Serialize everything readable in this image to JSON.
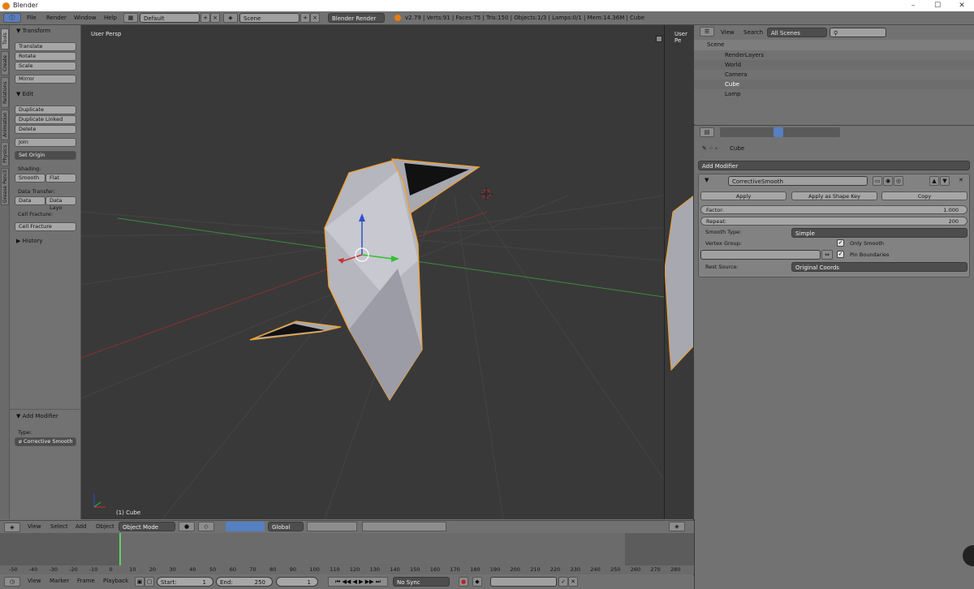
{
  "window": {
    "title": "Blender",
    "min": "–",
    "max": "☐",
    "close": "✕"
  },
  "menubar": {
    "items": [
      "File",
      "Render",
      "Window",
      "Help"
    ],
    "layout": "Default",
    "scene": "Scene",
    "engine": "Blender Render",
    "stats": "v2.79 | Verts:91 | Faces:75 | Tris:150 | Objects:1/3 | Lamps:0/1 | Mem:14.36M | Cube"
  },
  "tabs": [
    "Tools",
    "Create",
    "Relations",
    "Animation",
    "Physics",
    "Grease Pencil"
  ],
  "toolshelf": {
    "transform": {
      "title": "Transform",
      "buttons": [
        "Translate",
        "Rotate",
        "Scale",
        "Mirror"
      ]
    },
    "edit": {
      "title": "Edit",
      "buttons": [
        "Duplicate",
        "Duplicate Linked",
        "Delete",
        "Join"
      ],
      "set_origin": "Set Origin",
      "shading_label": "Shading:",
      "smooth": "Smooth",
      "flat": "Flat",
      "data_transfer_label": "Data Transfer:",
      "data": "Data",
      "data_layout": "Data Layo",
      "cell_fracture_label": "Cell Fracture:",
      "cell_fracture": "Cell Fracture"
    },
    "history": "History",
    "last_op": {
      "title": "Add Modifier",
      "type_label": "Type:",
      "type_value": "Corrective Smooth"
    }
  },
  "viewport": {
    "label": "User Persp",
    "object": "(1) Cube",
    "label2": "User Pe"
  },
  "outliner": {
    "view": "View",
    "search": "Search",
    "filter": "All Scenes",
    "items": [
      "Scene",
      "RenderLayers",
      "World",
      "Camera",
      "Cube",
      "Lamp"
    ]
  },
  "properties": {
    "breadcrumb": "Cube",
    "add_modifier": "Add Modifier",
    "modifier_name": "CorrectiveSmooth",
    "apply": "Apply",
    "apply_shape": "Apply as Shape Key",
    "copy": "Copy",
    "factor_label": "Factor:",
    "factor_value": "1.000",
    "repeat_label": "Repeat:",
    "repeat_value": "200",
    "smooth_type_label": "Smooth Type:",
    "smooth_type_value": "Simple",
    "vertex_group_label": "Vertex Group:",
    "only_smooth": "Only Smooth",
    "pin_boundaries": "Pin Boundaries",
    "rest_source_label": "Rest Source:",
    "rest_source_value": "Original Coords"
  },
  "view_header": {
    "items": [
      "View",
      "Select",
      "Add",
      "Object"
    ],
    "mode": "Object Mode",
    "orientation": "Global"
  },
  "timeline": {
    "ticks": [
      "-50",
      "-40",
      "-30",
      "-20",
      "-10",
      "0",
      "10",
      "20",
      "30",
      "40",
      "50",
      "60",
      "70",
      "80",
      "90",
      "100",
      "110",
      "120",
      "130",
      "140",
      "150",
      "160",
      "170",
      "180",
      "190",
      "200",
      "210",
      "220",
      "230",
      "240",
      "250",
      "260",
      "270",
      "280"
    ],
    "menu": [
      "View",
      "Marker",
      "Frame",
      "Playback"
    ],
    "start_label": "Start:",
    "start": "1",
    "end_label": "End:",
    "end": "250",
    "current": "1",
    "sync": "No Sync"
  },
  "colors": {
    "accent": "#e87d0d",
    "selected": "#5680c2",
    "mesh": "#b8b8c0",
    "outline": "#f0a030"
  }
}
